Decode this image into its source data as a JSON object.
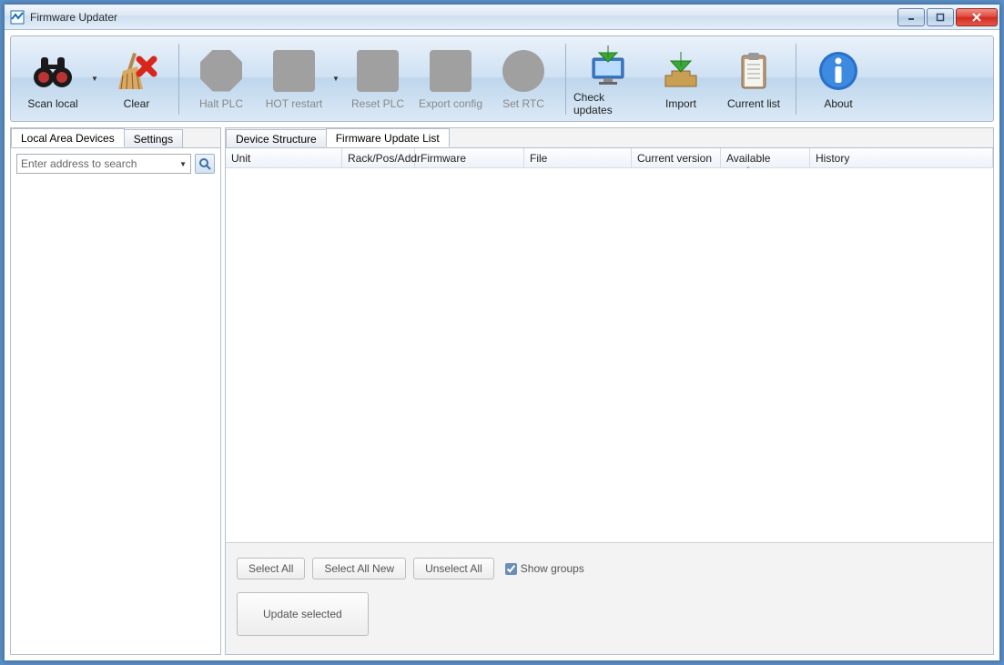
{
  "window": {
    "title": "Firmware Updater"
  },
  "toolbar": {
    "scan_local": "Scan local",
    "clear": "Clear",
    "halt_plc": "Halt PLC",
    "hot_restart": "HOT restart",
    "reset_plc": "Reset PLC",
    "export_config": "Export config",
    "set_rtc": "Set RTC",
    "check_updates": "Check updates",
    "import": "Import",
    "current_list": "Current list",
    "about": "About"
  },
  "left_panel": {
    "tabs": {
      "devices": "Local Area Devices",
      "settings": "Settings"
    },
    "search_placeholder": "Enter address to search"
  },
  "right_panel": {
    "tabs": {
      "structure": "Device Structure",
      "update_list": "Firmware Update List"
    },
    "columns": {
      "unit": "Unit",
      "rack": "Rack/Pos/Addr",
      "firmware": "Firmware",
      "file": "File",
      "current_version": "Current version",
      "available_version": "Available version",
      "history": "History"
    },
    "buttons": {
      "select_all": "Select All",
      "select_all_new": "Select All New",
      "unselect_all": "Unselect All",
      "show_groups": "Show groups",
      "update_selected": "Update selected"
    }
  }
}
